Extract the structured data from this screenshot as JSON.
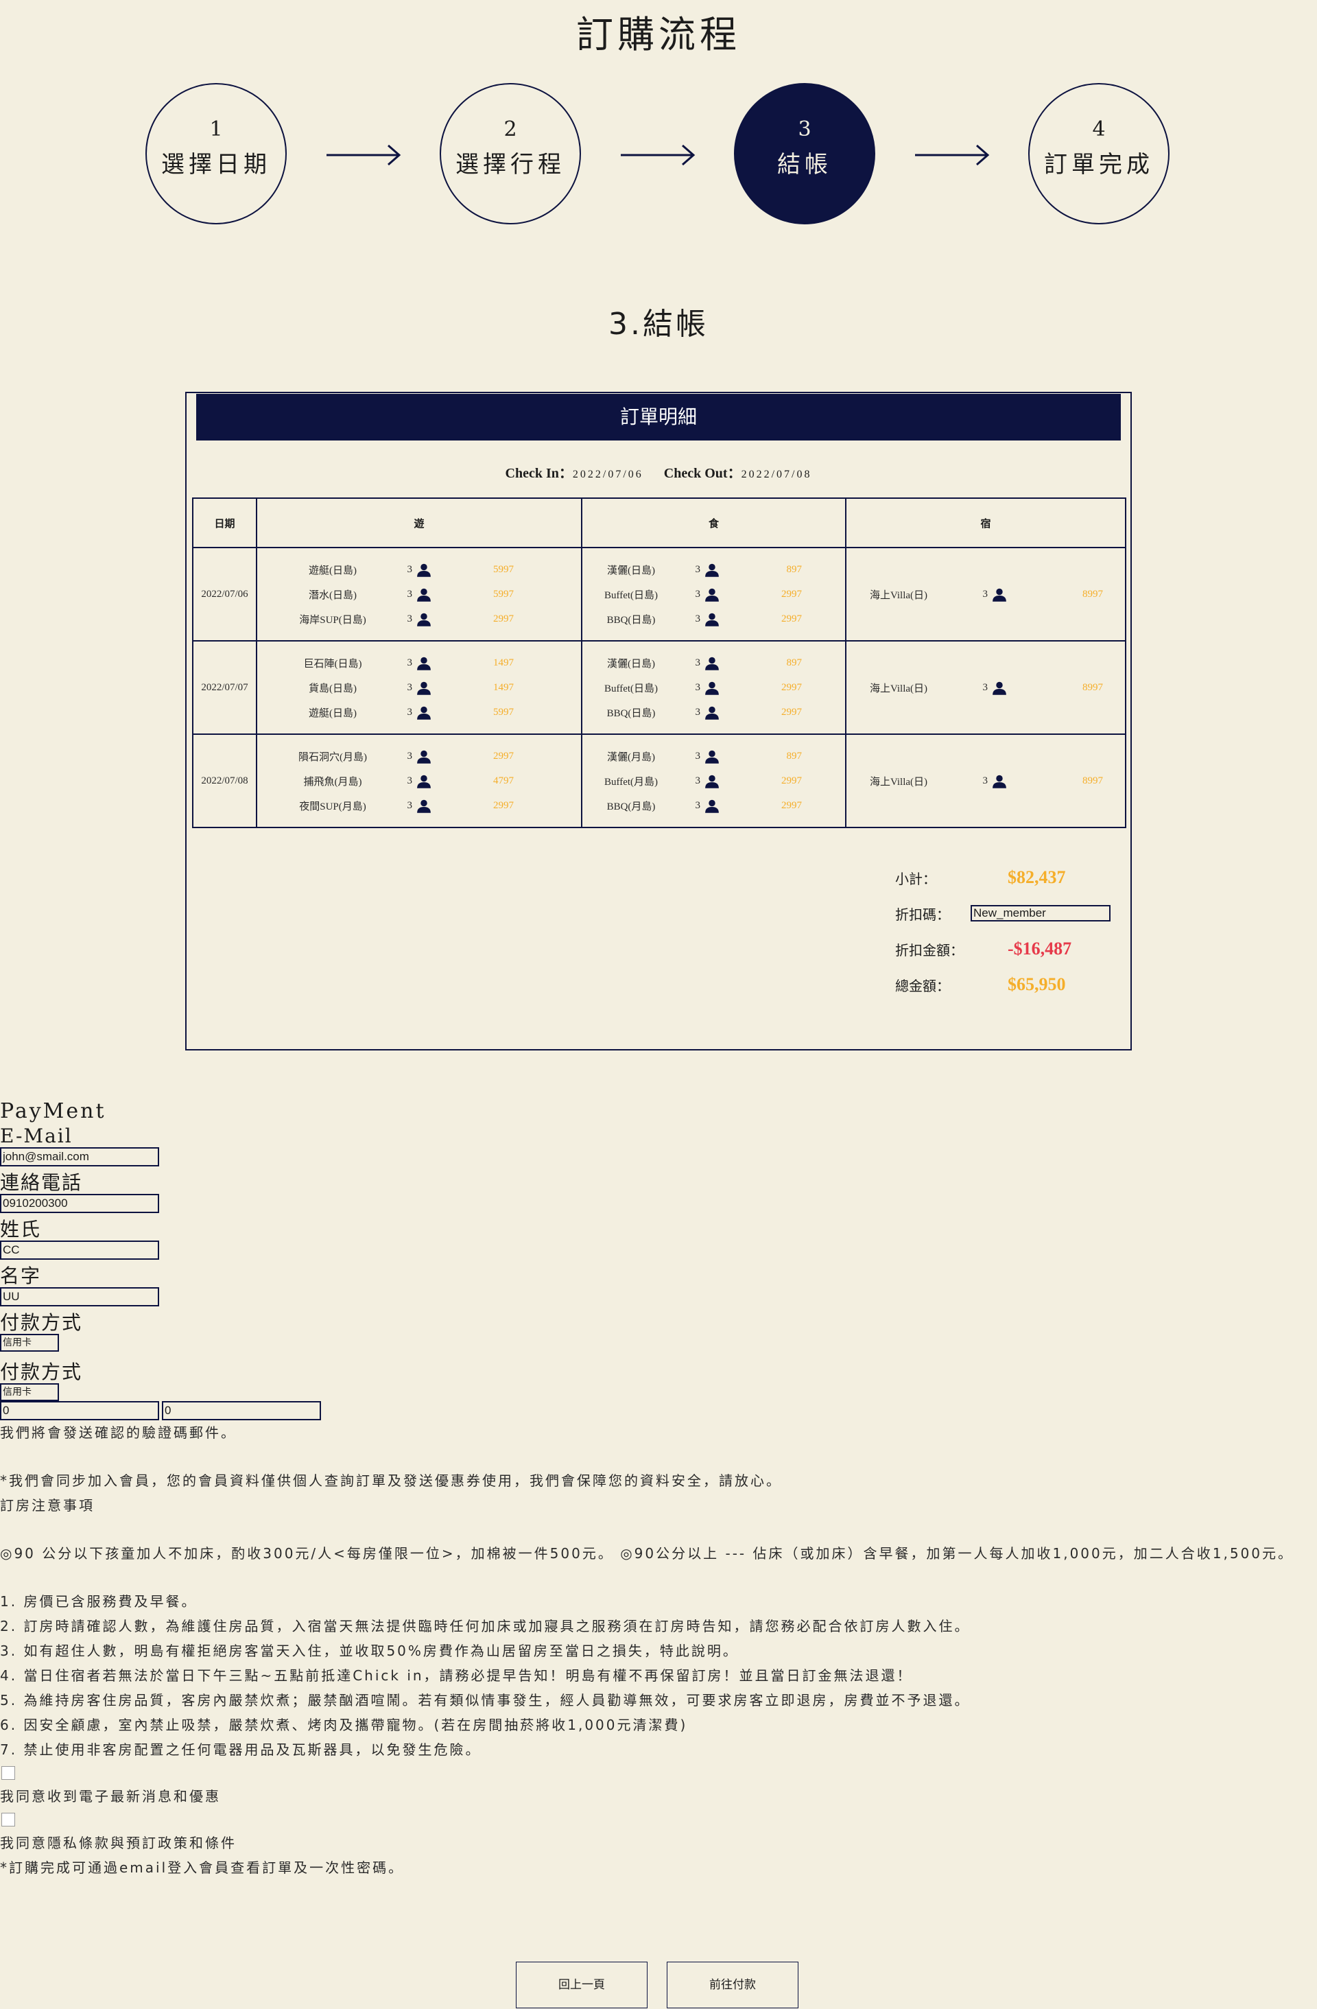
{
  "page_title": "訂購流程",
  "steps": [
    {
      "num": "1",
      "label": "選擇日期"
    },
    {
      "num": "2",
      "label": "選擇行程"
    },
    {
      "num": "3",
      "label": "結帳"
    },
    {
      "num": "4",
      "label": "訂單完成"
    }
  ],
  "active_step": 3,
  "section_title": "3.結帳",
  "order": {
    "header": "訂單明細",
    "check_in_label": "Check In：",
    "check_in": "2022/07/06",
    "check_out_label": "Check Out：",
    "check_out": "2022/07/08",
    "columns": [
      "日期",
      "遊",
      "食",
      "宿"
    ],
    "rows": [
      {
        "date": "2022/07/06",
        "play": [
          {
            "name": "遊艇(日島)",
            "qty": "3",
            "price": "5997"
          },
          {
            "name": "潛水(日島)",
            "qty": "3",
            "price": "5997"
          },
          {
            "name": "海岸SUP(日島)",
            "qty": "3",
            "price": "2997"
          }
        ],
        "food": [
          {
            "name": "漢儷(日島)",
            "qty": "3",
            "price": "897"
          },
          {
            "name": "Buffet(日島)",
            "qty": "3",
            "price": "2997"
          },
          {
            "name": "BBQ(日島)",
            "qty": "3",
            "price": "2997"
          }
        ],
        "stay": {
          "name": "海上Villa(日)",
          "qty": "3",
          "price": "8997"
        }
      },
      {
        "date": "2022/07/07",
        "play": [
          {
            "name": "巨石陣(日島)",
            "qty": "3",
            "price": "1497"
          },
          {
            "name": "貨島(日島)",
            "qty": "3",
            "price": "1497"
          },
          {
            "name": "遊艇(日島)",
            "qty": "3",
            "price": "5997"
          }
        ],
        "food": [
          {
            "name": "漢儷(日島)",
            "qty": "3",
            "price": "897"
          },
          {
            "name": "Buffet(日島)",
            "qty": "3",
            "price": "2997"
          },
          {
            "name": "BBQ(日島)",
            "qty": "3",
            "price": "2997"
          }
        ],
        "stay": {
          "name": "海上Villa(日)",
          "qty": "3",
          "price": "8997"
        }
      },
      {
        "date": "2022/07/08",
        "play": [
          {
            "name": "隕石洞穴(月島)",
            "qty": "3",
            "price": "2997"
          },
          {
            "name": "捕飛魚(月島)",
            "qty": "3",
            "price": "4797"
          },
          {
            "name": "夜間SUP(月島)",
            "qty": "3",
            "price": "2997"
          }
        ],
        "food": [
          {
            "name": "漢儷(月島)",
            "qty": "3",
            "price": "897"
          },
          {
            "name": "Buffet(月島)",
            "qty": "3",
            "price": "2997"
          },
          {
            "name": "BBQ(月島)",
            "qty": "3",
            "price": "2997"
          }
        ],
        "stay": {
          "name": "海上Villa(日)",
          "qty": "3",
          "price": "8997"
        }
      }
    ],
    "summary": {
      "subtotal_label": "小計：",
      "subtotal": "$82,437",
      "coupon_label": "折扣碼：",
      "coupon_value": "New_member",
      "discount_label": "折扣金額：",
      "discount": "-$16,487",
      "total_label": "總金額：",
      "total": "$65,950"
    }
  },
  "payment": {
    "heading": "PayMent",
    "email_label": "E-Mail",
    "email_value": "john@smail.com",
    "phone_label": "連絡電話",
    "phone_value": "0910200300",
    "lastname_label": "姓氏",
    "lastname_value": "CC",
    "firstname_label": "名字",
    "firstname_value": "UU",
    "method_label_1": "付款方式",
    "method_value_1": "信用卡",
    "method_label_2": "付款方式",
    "method_value_2": "信用卡",
    "extra_value_1": "0",
    "extra_value_2": "0",
    "note_verify": "我們將會發送確認的驗證碼郵件。",
    "note_member": "*我們會同步加入會員，您的會員資料僅供個人查詢訂單及發送優惠券使用，我們會保障您的資料安全，請放心。",
    "notice_title": "訂房注意事項",
    "notice_children": "◎90 公分以下孩童加人不加床，酌收300元/人<每房僅限一位>，加棉被一件500元。 ◎90公分以上 --- 佔床（或加床）含早餐，加第一人每人加收1,000元，加二人合收1,500元。",
    "rules": [
      "1. 房價已含服務費及早餐。",
      "2. 訂房時請確認人數，為維護住房品質，入宿當天無法提供臨時任何加床或加寢具之服務須在訂房時告知，請您務必配合依訂房人數入住。",
      "3. 如有超住人數，明島有權拒絕房客當天入住，並收取50%房費作為山居留房至當日之損失，特此說明。",
      "4. 當日住宿者若無法於當日下午三點~五點前抵達Chick in，請務必提早告知！明島有權不再保留訂房！並且當日訂金無法退還！",
      "5. 為維持房客住房品質，客房內嚴禁炊煮；嚴禁酗酒喧鬧。若有類似情事發生，經人員勸導無效，可要求房客立即退房，房費並不予退還。",
      "6. 因安全顧慮，室內禁止吸禁，嚴禁炊煮、烤肉及攜帶寵物。(若在房間抽菸將收1,000元清潔費)",
      "7. 禁止使用非客房配置之任何電器用品及瓦斯器具，以免發生危險。"
    ],
    "agree_news": "我同意收到電子最新消息和優惠",
    "agree_policy": "我同意隱私條款與預訂政策和條件",
    "note_after": "*訂購完成可通過email登入會員查看訂單及一次性密碼。"
  },
  "buttons": {
    "prev": "回上一頁",
    "next": "前往付款"
  },
  "colors": {
    "background": "#f3efe0",
    "navy": "#0d1340",
    "price": "#f5ae2a",
    "discount": "#e63a4a"
  }
}
